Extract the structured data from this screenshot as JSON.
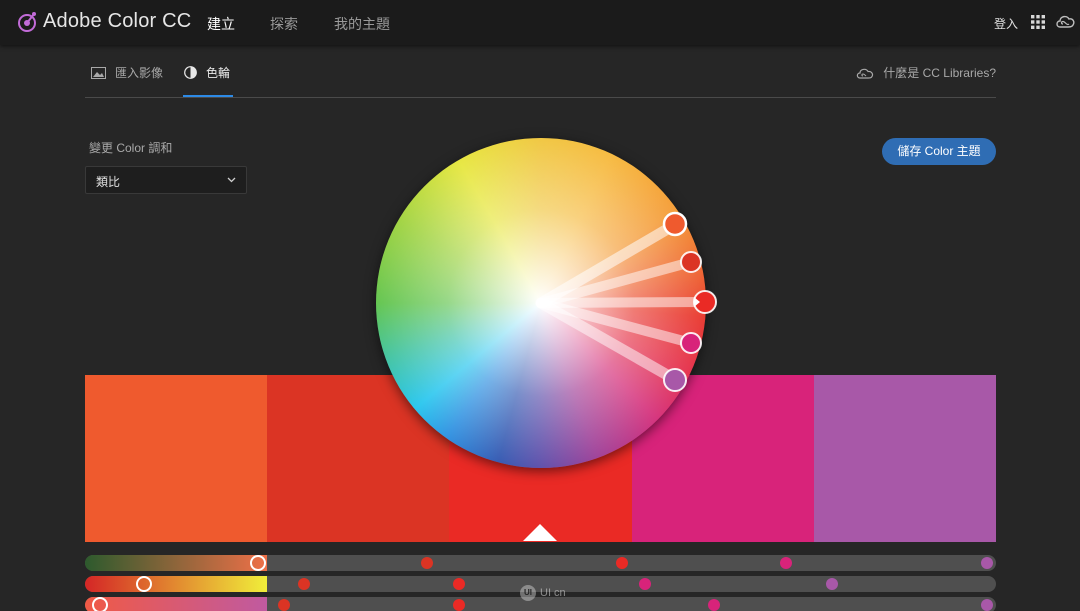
{
  "header": {
    "app_title": "Adobe Color CC",
    "nav": [
      "建立",
      "探索",
      "我的主題"
    ],
    "login": "登入",
    "icons": {
      "logo": "adobe-color-logo-icon",
      "apps": "apps-grid-icon",
      "cc": "creative-cloud-icon"
    }
  },
  "subtabs": {
    "import_image": "匯入影像",
    "color_wheel": "色輪",
    "libraries": "什麼是 CC Libraries?"
  },
  "harmony": {
    "label": "變更 Color 調和",
    "selected": "類比"
  },
  "save_button": "儲存 Color 主題",
  "swatches": [
    "#ef5a2e",
    "#db3424",
    "#ea2a25",
    "#d8237a",
    "#a858a8"
  ],
  "active_swatch": 2,
  "sliders": [
    {
      "fill_from": "#2d5a2d",
      "fill_to": "#ef7048",
      "handle_position": 0.19,
      "dot_positions": [
        0.375,
        0.59,
        0.77,
        0.99
      ]
    },
    {
      "fill_from": "#d42626",
      "fill_to": "#f0ee3a",
      "handle_position": 0.065,
      "dot_positions": [
        0.24,
        0.41,
        0.615,
        0.82
      ]
    },
    {
      "fill_from": "#f05a45",
      "fill_to": "#c05aa0",
      "handle_position": 0.017,
      "dot_positions": [
        0.218,
        0.41,
        0.69,
        0.99
      ]
    }
  ],
  "watermark": "UI cn"
}
